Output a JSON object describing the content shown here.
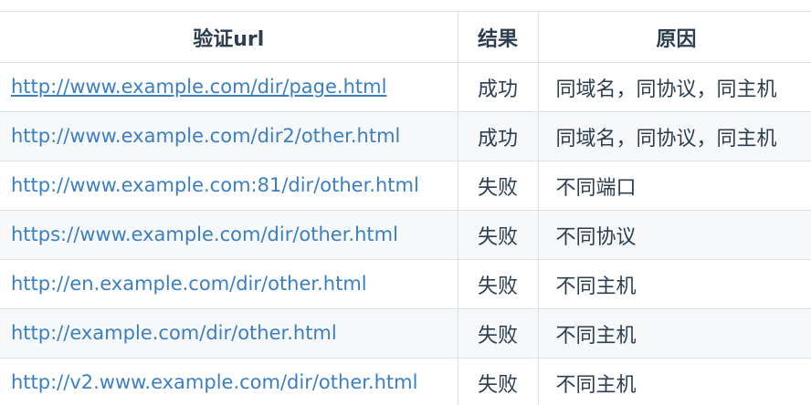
{
  "table": {
    "headers": [
      "验证url",
      "结果",
      "原因"
    ],
    "rows": [
      {
        "url": "http://www.example.com/dir/page.html",
        "result": "成功",
        "reason": "同域名，同协议，同主机"
      },
      {
        "url": "http://www.example.com/dir2/other.html",
        "result": "成功",
        "reason": "同域名，同协议，同主机"
      },
      {
        "url": "http://www.example.com:81/dir/other.html",
        "result": "失败",
        "reason": "不同端口"
      },
      {
        "url": "https://www.example.com/dir/other.html",
        "result": "失败",
        "reason": "不同协议"
      },
      {
        "url": "http://en.example.com/dir/other.html",
        "result": "失败",
        "reason": "不同主机"
      },
      {
        "url": "http://example.com/dir/other.html",
        "result": "失败",
        "reason": "不同主机"
      },
      {
        "url": "http://v2.www.example.com/dir/other.html",
        "result": "失败",
        "reason": "不同主机"
      }
    ]
  },
  "colors": {
    "link": "#3c7fc1",
    "text": "#2c3e50",
    "stripe": "#f6f8fa",
    "border": "#dfe2e5"
  }
}
